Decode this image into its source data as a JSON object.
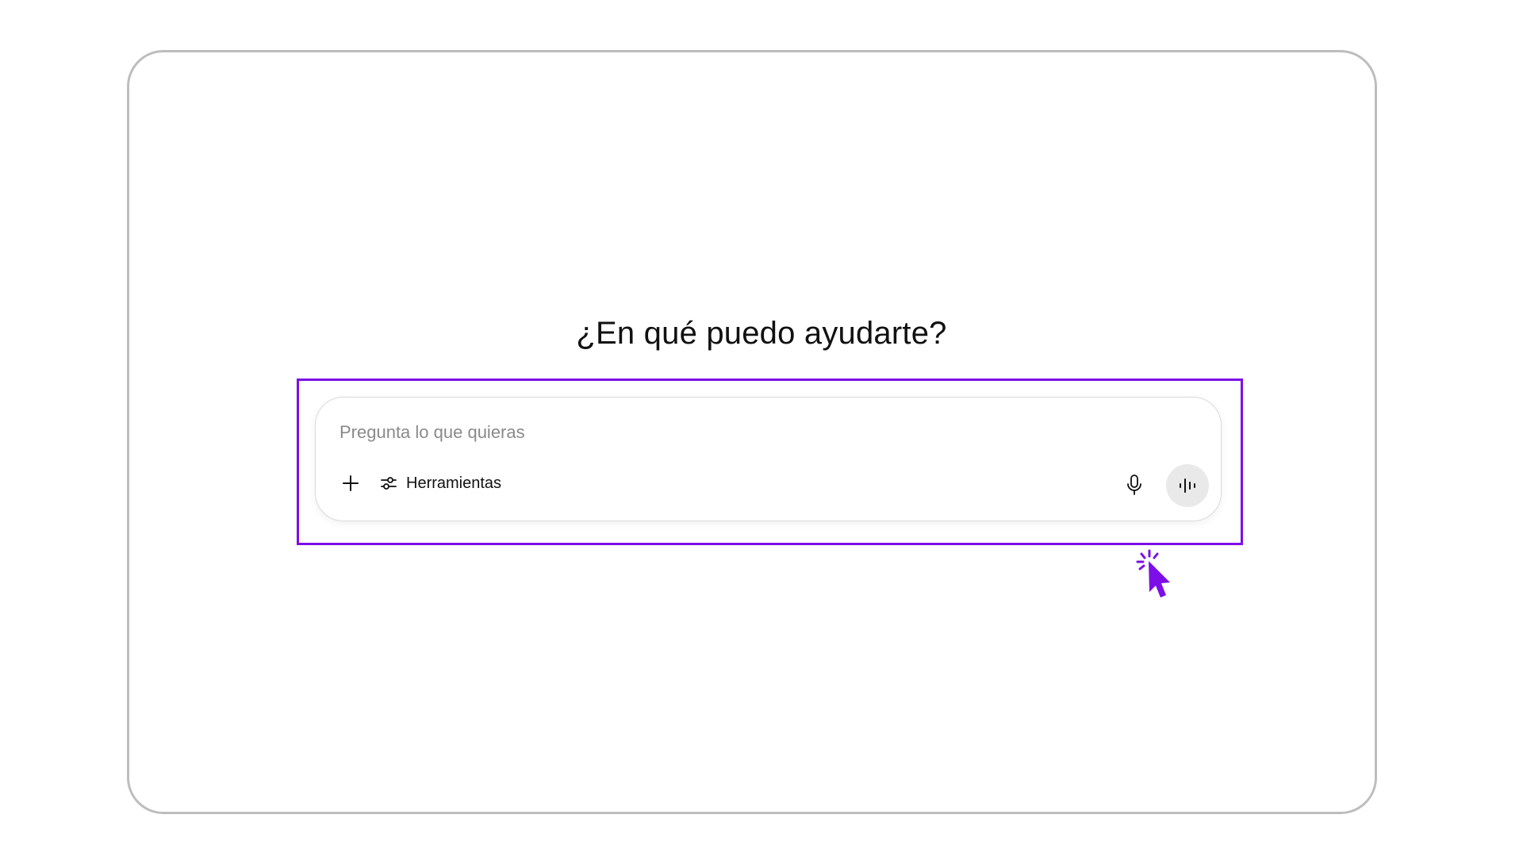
{
  "heading": "¿En qué puedo ayudarte?",
  "composer": {
    "placeholder": "Pregunta lo que quieras",
    "value": "",
    "add_icon": "plus-icon",
    "tools_icon": "sliders-icon",
    "tools_label": "Herramientas",
    "mic_icon": "microphone-icon",
    "voice_icon": "voice-waveform-icon"
  },
  "annotation": {
    "highlight_color": "#7c0ee8",
    "cursor_icon": "click-cursor-icon"
  },
  "colors": {
    "text": "#111111",
    "placeholder": "#8a8a8a",
    "frame_border": "#bdbdbd",
    "voice_button_bg": "#e9e9e9"
  }
}
